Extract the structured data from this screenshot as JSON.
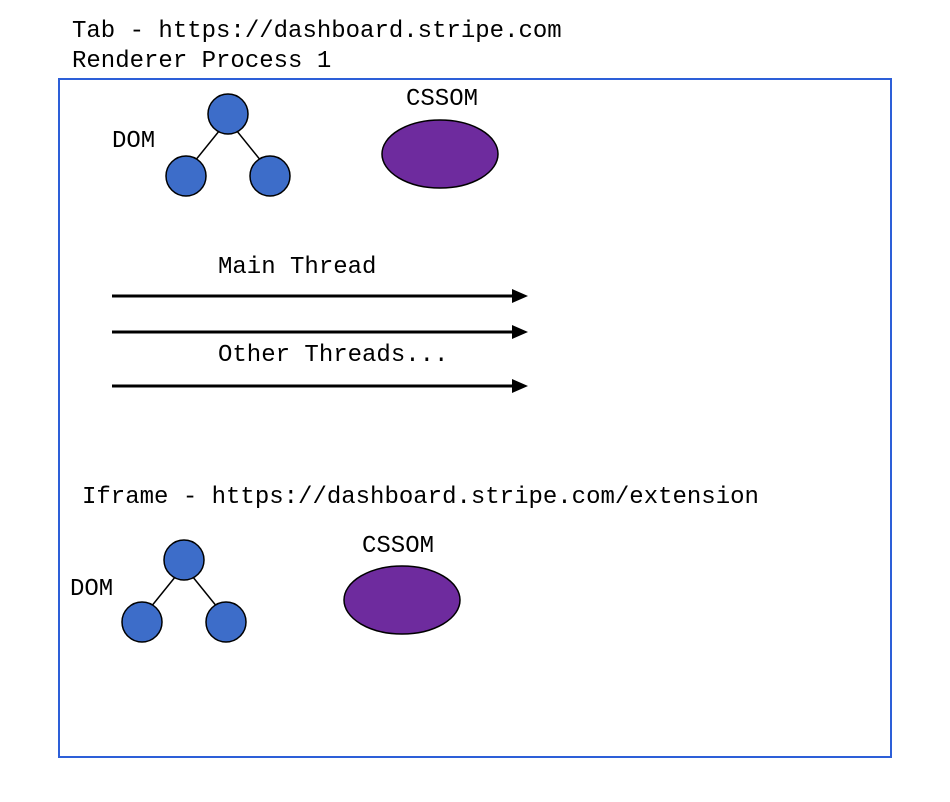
{
  "tab": {
    "prefix": "Tab - ",
    "url": "https://dashboard.stripe.com"
  },
  "process": {
    "label": "Renderer Process 1"
  },
  "upper": {
    "dom_label": "DOM",
    "cssom_label": "CSSOM"
  },
  "threads": {
    "main": "Main Thread",
    "other": "Other Threads..."
  },
  "iframe": {
    "prefix": "Iframe - ",
    "url": "https://dashboard.stripe.com/extension"
  },
  "lower": {
    "dom_label": "DOM",
    "cssom_label": "CSSOM"
  },
  "colors": {
    "box_border": "#2d5fd8",
    "node_fill": "#3d6dc9",
    "ellipse_fill": "#6e2b9e"
  }
}
